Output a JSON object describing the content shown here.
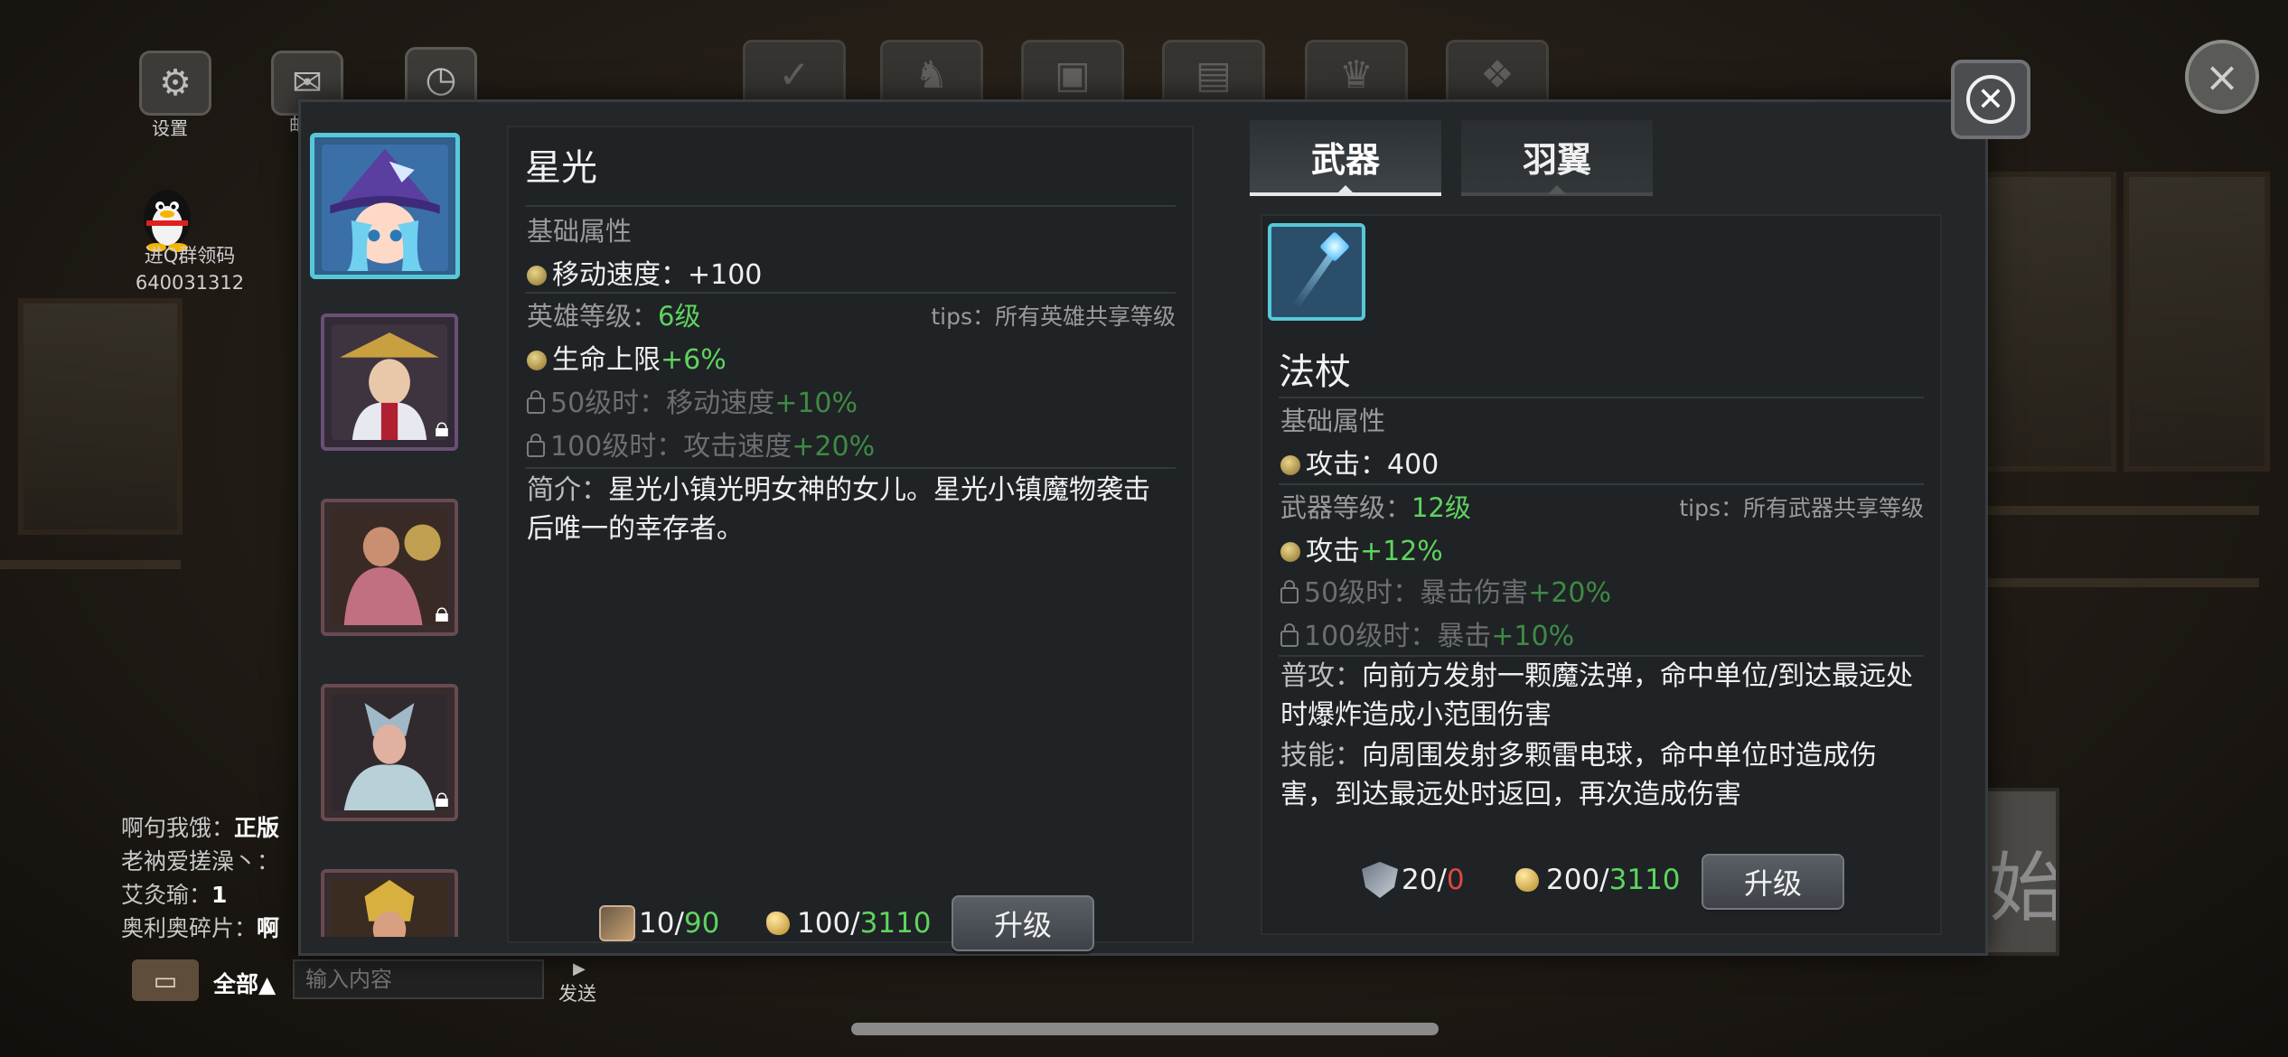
{
  "hud": {
    "settings_label": "设置",
    "mail_label": "邮",
    "qq_label_line1": "进Q群领码",
    "qq_label_line2": "640031312"
  },
  "chat": {
    "lines": [
      {
        "name": "啊句我饿：",
        "msg": "正版"
      },
      {
        "name": "老衲爱搓澡丶：",
        "msg": ""
      },
      {
        "name": "艾灸瑜：",
        "msg": "1"
      },
      {
        "name": "奥利奥碎片：",
        "msg": "啊"
      }
    ],
    "scope": "全部▲",
    "input_placeholder": "输入内容",
    "send_label": "发送",
    "send_arrow": "▶"
  },
  "start_button_text": "始",
  "hero": {
    "name": "星光",
    "base_attr_title": "基础属性",
    "base_attr": "移动速度：+100",
    "level_label": "英雄等级：",
    "level_value": "6级",
    "tips": "tips：所有英雄共享等级",
    "level_bonus_label": "生命上限",
    "level_bonus_value": "+6%",
    "unlock_50_label": "50级时：移动速度",
    "unlock_50_value": "+10%",
    "unlock_100_label": "100级时：攻击速度",
    "unlock_100_value": "+20%",
    "desc_key": "简介：",
    "desc": "星光小镇光明女神的女儿。星光小镇魔物袭击后唯一的幸存者。",
    "cost_shards_have": "10",
    "cost_shards_sep": "/",
    "cost_shards_need": "90",
    "cost_ore_have": "100",
    "cost_ore_sep": "/",
    "cost_ore_need": "3110",
    "upgrade_label": "升级"
  },
  "heroes_list": [
    {
      "state": "selected"
    },
    {
      "state": "locked"
    },
    {
      "state": "locked"
    },
    {
      "state": "locked"
    },
    {
      "state": "locked"
    }
  ],
  "tabs": {
    "weapon": "武器",
    "wings": "羽翼"
  },
  "weapon": {
    "name": "法杖",
    "base_attr_title": "基础属性",
    "base_attr": "攻击：400",
    "level_label": "武器等级：",
    "level_value": "12级",
    "tips": "tips：所有武器共享等级",
    "level_bonus_label": "攻击",
    "level_bonus_value": "+12%",
    "unlock_50_label": "50级时：暴击伤害",
    "unlock_50_value": "+20%",
    "unlock_100_label": "100级时：暴击",
    "unlock_100_value": "+10%",
    "normal_key": "普攻：",
    "normal_desc": "向前方发射一颗魔法弹，命中单位/到达最远处时爆炸造成小范围伤害",
    "skill_key": "技能：",
    "skill_desc": "向周围发射多颗雷电球，命中单位时造成伤害，到达最远处时返回，再次造成伤害",
    "cost_stone_have": "20",
    "cost_stone_sep": "/",
    "cost_stone_need": "0",
    "cost_ore_have": "200",
    "cost_ore_sep": "/",
    "cost_ore_need": "3110",
    "upgrade_label": "升级"
  },
  "colors": {
    "green": "#5fd35f",
    "red": "#e04545",
    "selected_border": "#58c8d8"
  }
}
